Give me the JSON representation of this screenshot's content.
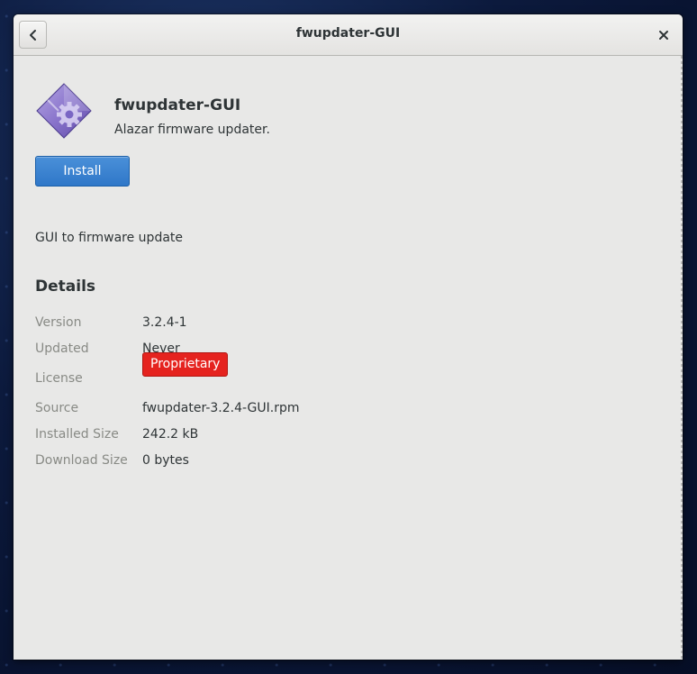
{
  "window": {
    "title": "fwupdater-GUI"
  },
  "header": {
    "back_icon": "chevron-left-icon",
    "close_icon": "close-icon"
  },
  "app": {
    "icon": "application-package-icon",
    "name": "fwupdater-GUI",
    "summary": "Alazar firmware updater.",
    "install_label": "Install",
    "description": "GUI to firmware update"
  },
  "details": {
    "heading": "Details",
    "rows": [
      {
        "label": "Version",
        "value": "3.2.4-1"
      },
      {
        "label": "Updated",
        "value": "Never"
      },
      {
        "label": "License",
        "value": "Proprietary"
      },
      {
        "label": "Source",
        "value": "fwupdater-3.2.4-GUI.rpm"
      },
      {
        "label": "Installed Size",
        "value": "242.2 kB"
      },
      {
        "label": "Download Size",
        "value": "0 bytes"
      }
    ]
  },
  "colors": {
    "accent": "#3584e4",
    "license_badge": "#e5231f",
    "window_bg": "#e8e8e7"
  }
}
